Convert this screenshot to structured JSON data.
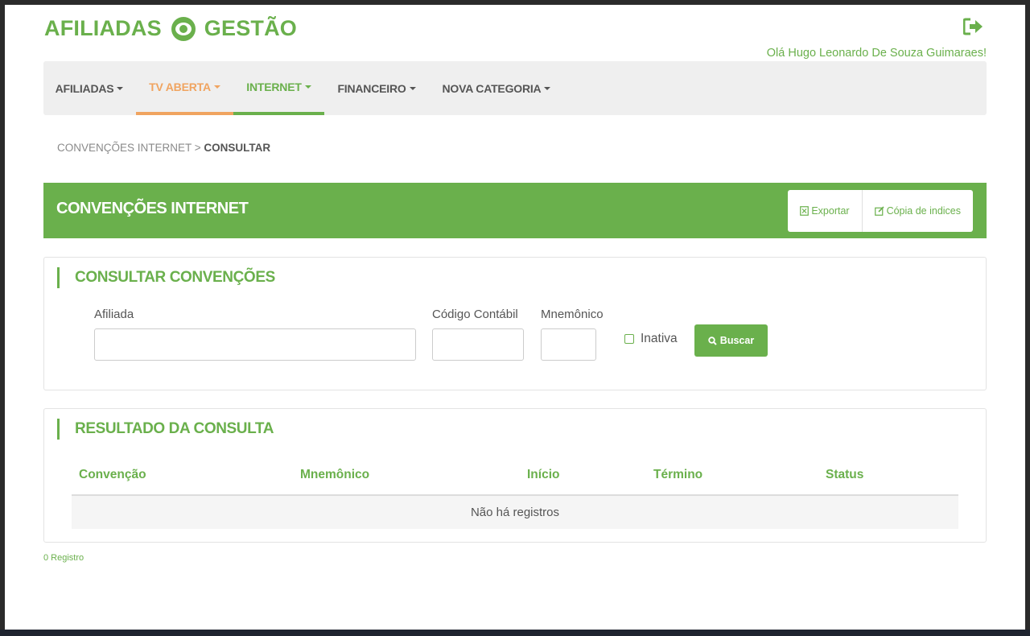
{
  "brand": {
    "left": "AFILIADAS",
    "right": "GESTÃO"
  },
  "header": {
    "greeting": "Olá Hugo Leonardo De Souza Guimaraes!"
  },
  "nav": {
    "items": [
      {
        "label": "AFILIADAS"
      },
      {
        "label": "TV ABERTA"
      },
      {
        "label": "INTERNET"
      },
      {
        "label": "FINANCEIRO"
      },
      {
        "label": "NOVA CATEGORIA"
      }
    ]
  },
  "breadcrumb": {
    "parent": "CONVENÇÕES INTERNET",
    "separator": " > ",
    "current": "CONSULTAR"
  },
  "banner": {
    "title": "CONVENÇÕES INTERNET",
    "export_label": "Exportar",
    "copy_label": "Cópia de indices"
  },
  "search": {
    "title": "CONSULTAR CONVENÇÕES",
    "afiliada_label": "Afiliada",
    "afiliada_value": "",
    "codigo_label": "Código Contábil",
    "codigo_value": "",
    "mnemonico_label": "Mnemônico",
    "mnemonico_value": "",
    "inativa_label": "Inativa",
    "inativa_checked": false,
    "search_label": "Buscar"
  },
  "results": {
    "title": "RESULTADO DA CONSULTA",
    "columns": [
      "Convenção",
      "Mnemônico",
      "Início",
      "Término",
      "Status"
    ],
    "rows": [],
    "empty_message": "Não há registros",
    "count_label": "0 Registro"
  },
  "colors": {
    "accent": "#6ab04c",
    "tv_aberta": "#f0a460"
  }
}
